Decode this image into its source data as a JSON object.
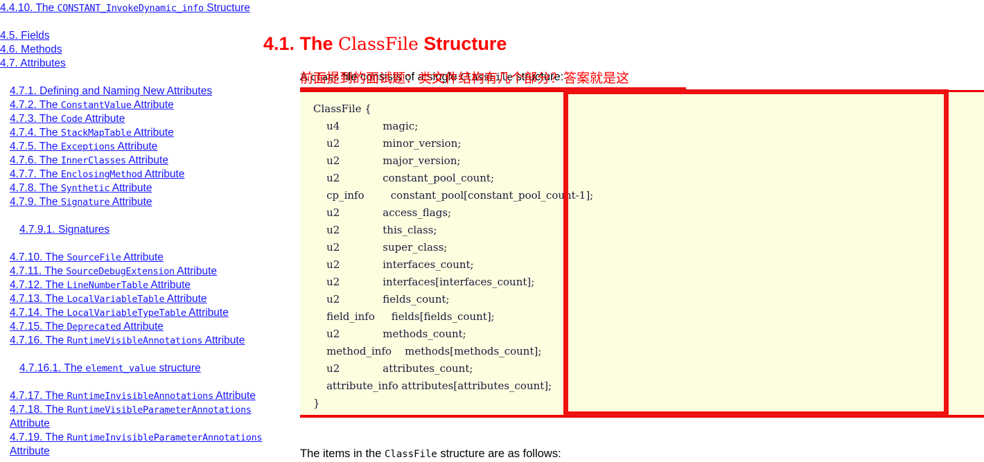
{
  "sidebar": {
    "items": [
      {
        "level": 0,
        "prefix": "4.4.10. The ",
        "code": "CONSTANT_InvokeDynamic_info",
        "suffix": " Structure"
      },
      {
        "level": 0,
        "gap_before": true,
        "prefix": "4.5. Fields",
        "code": "",
        "suffix": ""
      },
      {
        "level": 0,
        "prefix": "4.6. Methods",
        "code": "",
        "suffix": ""
      },
      {
        "level": 0,
        "prefix": "4.7. Attributes",
        "code": "",
        "suffix": ""
      },
      {
        "level": 1,
        "gap_before": true,
        "prefix": "4.7.1. Defining and Naming New Attributes",
        "code": "",
        "suffix": ""
      },
      {
        "level": 1,
        "prefix": "4.7.2. The ",
        "code": "ConstantValue",
        "suffix": " Attribute"
      },
      {
        "level": 1,
        "prefix": "4.7.3. The ",
        "code": "Code",
        "suffix": " Attribute"
      },
      {
        "level": 1,
        "prefix": "4.7.4. The ",
        "code": "StackMapTable",
        "suffix": " Attribute"
      },
      {
        "level": 1,
        "prefix": "4.7.5. The ",
        "code": "Exceptions",
        "suffix": " Attribute"
      },
      {
        "level": 1,
        "prefix": "4.7.6. The ",
        "code": "InnerClasses",
        "suffix": " Attribute"
      },
      {
        "level": 1,
        "prefix": "4.7.7. The ",
        "code": "EnclosingMethod",
        "suffix": " Attribute"
      },
      {
        "level": 1,
        "prefix": "4.7.8. The ",
        "code": "Synthetic",
        "suffix": " Attribute"
      },
      {
        "level": 1,
        "prefix": "4.7.9. The ",
        "code": "Signature",
        "suffix": " Attribute"
      },
      {
        "level": 2,
        "gap_before": true,
        "prefix": "4.7.9.1. Signatures",
        "code": "",
        "suffix": ""
      },
      {
        "level": 1,
        "gap_before": true,
        "prefix": "4.7.10. The ",
        "code": "SourceFile",
        "suffix": " Attribute"
      },
      {
        "level": 1,
        "prefix": "4.7.11. The ",
        "code": "SourceDebugExtension",
        "suffix": " Attribute"
      },
      {
        "level": 1,
        "prefix": "4.7.12. The ",
        "code": "LineNumberTable",
        "suffix": " Attribute"
      },
      {
        "level": 1,
        "prefix": "4.7.13. The ",
        "code": "LocalVariableTable",
        "suffix": " Attribute"
      },
      {
        "level": 1,
        "prefix": "4.7.14. The ",
        "code": "LocalVariableTypeTable",
        "suffix": " Attribute"
      },
      {
        "level": 1,
        "prefix": "4.7.15. The ",
        "code": "Deprecated",
        "suffix": " Attribute"
      },
      {
        "level": 1,
        "prefix": "4.7.16. The ",
        "code": "RuntimeVisibleAnnotations",
        "suffix": " Attribute"
      },
      {
        "level": 2,
        "gap_before": true,
        "prefix": "4.7.16.1. The ",
        "code": "element_value",
        "suffix": " structure"
      },
      {
        "level": 1,
        "gap_before": true,
        "prefix": "4.7.17. The ",
        "code": "RuntimeInvisibleAnnotations",
        "suffix": " Attribute"
      },
      {
        "level": 1,
        "prefix": "4.7.18. The ",
        "code": "RuntimeVisibleParameterAnnotations",
        "suffix": " Attribute"
      },
      {
        "level": 1,
        "prefix": "4.7.19. The ",
        "code": "RuntimeInvisibleParameterAnnotations",
        "suffix": " Attribute"
      }
    ]
  },
  "main": {
    "title": {
      "before": "4.1. The ",
      "code": "ClassFile",
      "after": " Structure"
    },
    "intro": {
      "t1": "A ",
      "c1": "class",
      "t2": " file consists of a single ",
      "c2": "ClassFile",
      "t3": " structure:"
    },
    "annotation_note": "前面提到的面试题：类文件结构有几个部分？答案就是这",
    "code": "ClassFile {\n    u4             magic;\n    u2             minor_version;\n    u2             major_version;\n    u2             constant_pool_count;\n    cp_info        constant_pool[constant_pool_count-1];\n    u2             access_flags;\n    u2             this_class;\n    u2             super_class;\n    u2             interfaces_count;\n    u2             interfaces[interfaces_count];\n    u2             fields_count;\n    field_info     fields[fields_count];\n    u2             methods_count;\n    method_info    methods[methods_count];\n    u2             attributes_count;\n    attribute_info attributes[attributes_count];\n}",
    "items_para": {
      "t1": "The items in the ",
      "c1": "ClassFile",
      "t2": " structure are as follows:"
    }
  },
  "colors": {
    "link": "#1414ff",
    "heading_red": "#ff0000",
    "annotation_red": "#ee1111",
    "code_bg": "#fdfde0",
    "code_text": "#1a1a3a"
  }
}
